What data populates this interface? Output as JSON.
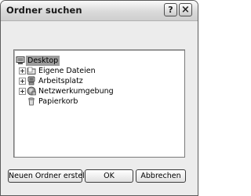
{
  "window": {
    "title": "Ordner suchen",
    "help_glyph": "?",
    "close_glyph": "×"
  },
  "tree": {
    "items": [
      {
        "label": "Desktop",
        "icon": "desktop-icon",
        "selected": true,
        "expandable": false
      },
      {
        "label": "Eigene Dateien",
        "icon": "folder-icon",
        "selected": false,
        "expandable": true
      },
      {
        "label": "Arbeitsplatz",
        "icon": "computer-icon",
        "selected": false,
        "expandable": true
      },
      {
        "label": "Netzwerkumgebung",
        "icon": "network-icon",
        "selected": false,
        "expandable": true
      },
      {
        "label": "Papierkorb",
        "icon": "recycle-bin-icon",
        "selected": false,
        "expandable": false
      }
    ]
  },
  "buttons": {
    "new_folder": "Neuen Ordner erstellen",
    "ok": "OK",
    "cancel": "Abbrechen"
  }
}
